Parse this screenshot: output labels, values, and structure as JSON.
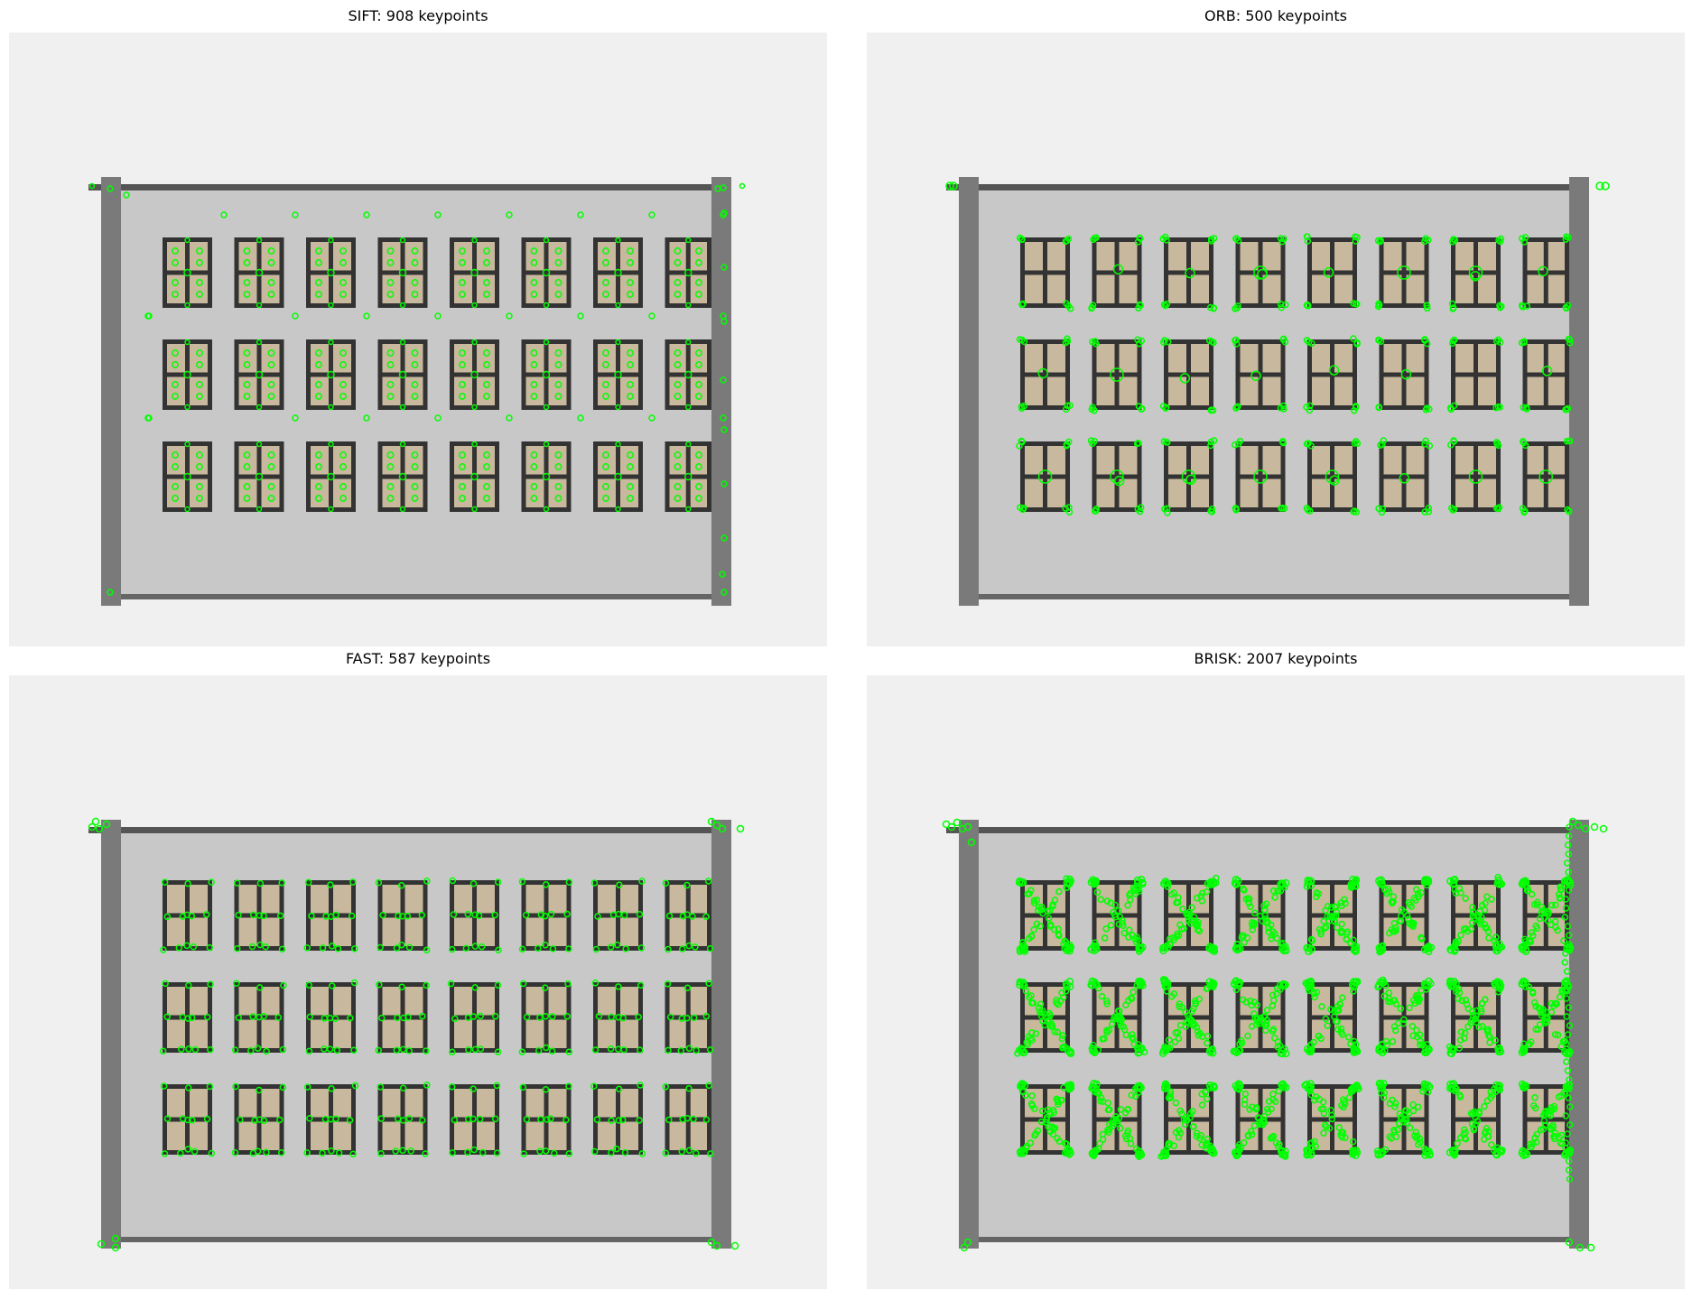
{
  "panels": [
    {
      "id": "sift",
      "title": "SIFT: 908 keypoints",
      "method": "SIFT",
      "count": 908
    },
    {
      "id": "orb",
      "title": "ORB: 500 keypoints",
      "method": "ORB",
      "count": 500
    },
    {
      "id": "fast",
      "title": "FAST: 587 keypoints",
      "method": "FAST",
      "count": 587
    },
    {
      "id": "brisk",
      "title": "BRISK: 2007 keypoints",
      "method": "BRISK",
      "count": 2007
    }
  ],
  "colors": {
    "background": "#f0f0f0",
    "facade": "#c8c8c8",
    "pillar": "#7a7a7a",
    "roof": "#555555",
    "base": "#666666",
    "window_frame": "#333333",
    "window_glass": "#c8b89e",
    "keypoint": "#00ff00"
  },
  "grid": {
    "rows": 3,
    "cols": 8
  }
}
